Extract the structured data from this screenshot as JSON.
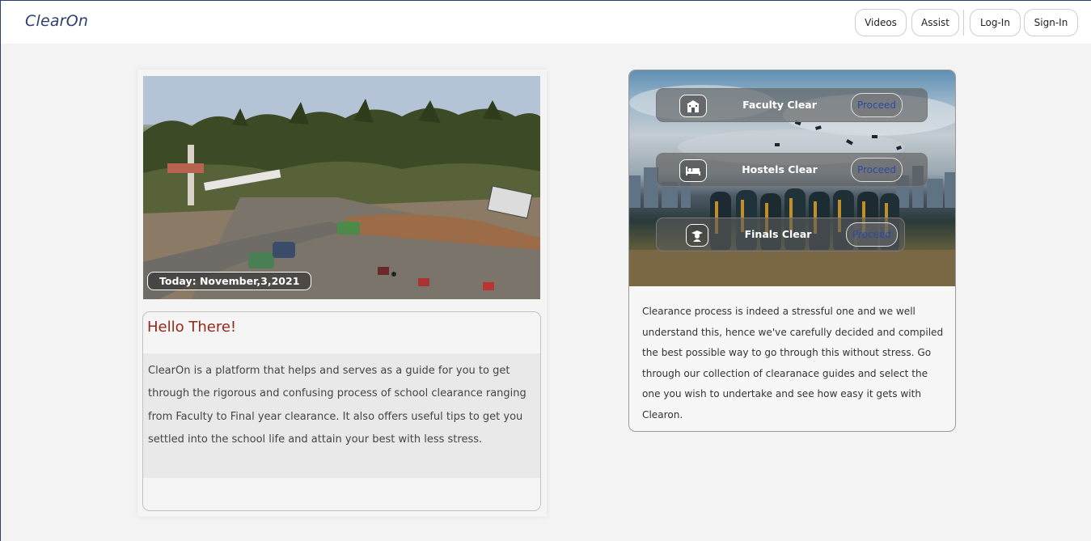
{
  "brand": "ClearOn",
  "nav": {
    "videos": "Videos",
    "assist": "Assist",
    "login": "Log-In",
    "signup": "Sign-In"
  },
  "left_card": {
    "date_label": "Today: November,3,2021",
    "hello_title": "Hello There!",
    "hello_text": "ClearOn is a platform that helps and serves as a guide for you to get through the rigorous and confusing process of school clearance ranging from Faculty to Final year clearance. It also offers useful tips to get you settled into the school life and attain your best with less stress."
  },
  "right_card": {
    "rows": [
      {
        "icon": "building-icon",
        "label": "Faculty Clear",
        "button": "Proceed"
      },
      {
        "icon": "bed-icon",
        "label": "Hostels Clear",
        "button": "Proceed"
      },
      {
        "icon": "graduate-icon",
        "label": "Finals Clear",
        "button": "Proceed"
      }
    ],
    "description": "Clearance process is indeed a stressful one and we well understand this, hence we've carefully decided and compiled the best possible way to go through this without stress. Go through our collection of clearanace guides and select the one you wish to undertake and see how easy it gets with Clearon."
  },
  "colors": {
    "brand": "#2d4070",
    "hello_title": "#8f2a1a",
    "proceed_text": "#2b4aa8"
  }
}
